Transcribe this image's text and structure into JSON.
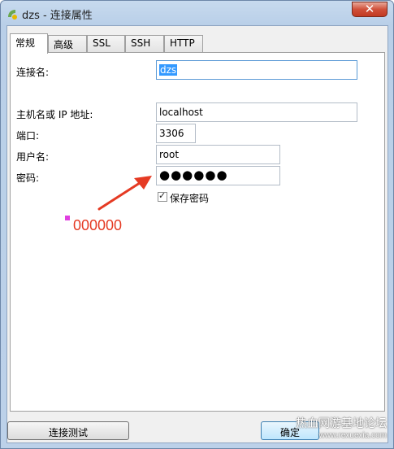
{
  "window": {
    "title": "dzs - 连接属性",
    "close_glyph": "✕"
  },
  "tabs": [
    {
      "label": "常规",
      "active": true
    },
    {
      "label": "高级"
    },
    {
      "label": "SSL"
    },
    {
      "label": "SSH"
    },
    {
      "label": "HTTP"
    }
  ],
  "form": {
    "connection_name": {
      "label": "连接名:",
      "value": "dzs"
    },
    "host": {
      "label": "主机名或 IP 地址:",
      "value": "localhost"
    },
    "port": {
      "label": "端口:",
      "value": "3306"
    },
    "user": {
      "label": "用户名:",
      "value": "root"
    },
    "password": {
      "label": "密码:",
      "value": "●●●●●●"
    },
    "save_password": {
      "label": "保存密码",
      "checked": true,
      "check_glyph": "✓"
    }
  },
  "annotation": {
    "text": "000000",
    "color": "#e53a23"
  },
  "buttons": {
    "test": "连接测试",
    "ok": "确定"
  },
  "watermark": {
    "line1": "热血网游基地论坛",
    "line2": "www.rexuexia.com"
  }
}
